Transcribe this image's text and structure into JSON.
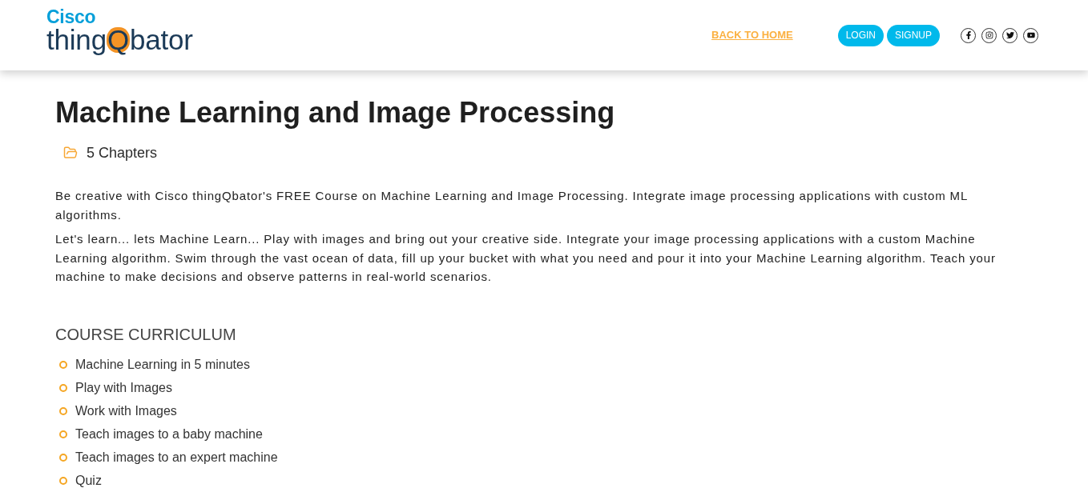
{
  "header": {
    "logo": {
      "brand": "Cisco",
      "wordmark": [
        "thing",
        "Q",
        "bator"
      ]
    },
    "nav_link": "BACK TO HOME",
    "buttons": [
      "LOGIN",
      "SIGNUP"
    ]
  },
  "course": {
    "title": "Machine Learning and Image Processing",
    "chapters": "5 Chapters",
    "description": [
      "Be creative with Cisco thingQbator's FREE Course on Machine Learning and Image Processing. Integrate image processing applications with custom ML algorithms.",
      "Let's learn... lets Machine Learn... Play with images and bring out your creative side. Integrate your image processing applications with a custom Machine Learning algorithm. Swim through the vast ocean of data, fill up your bucket with what you need and pour it into your Machine Learning algorithm. Teach your machine to make decisions and observe patterns in real-world scenarios."
    ]
  },
  "curriculum": {
    "heading": "COURSE CURRICULUM",
    "items": [
      "Machine Learning in 5 minutes",
      "Play with Images",
      "Work with Images",
      "Teach images to a baby machine",
      "Teach images to an expert machine",
      "Quiz"
    ]
  }
}
